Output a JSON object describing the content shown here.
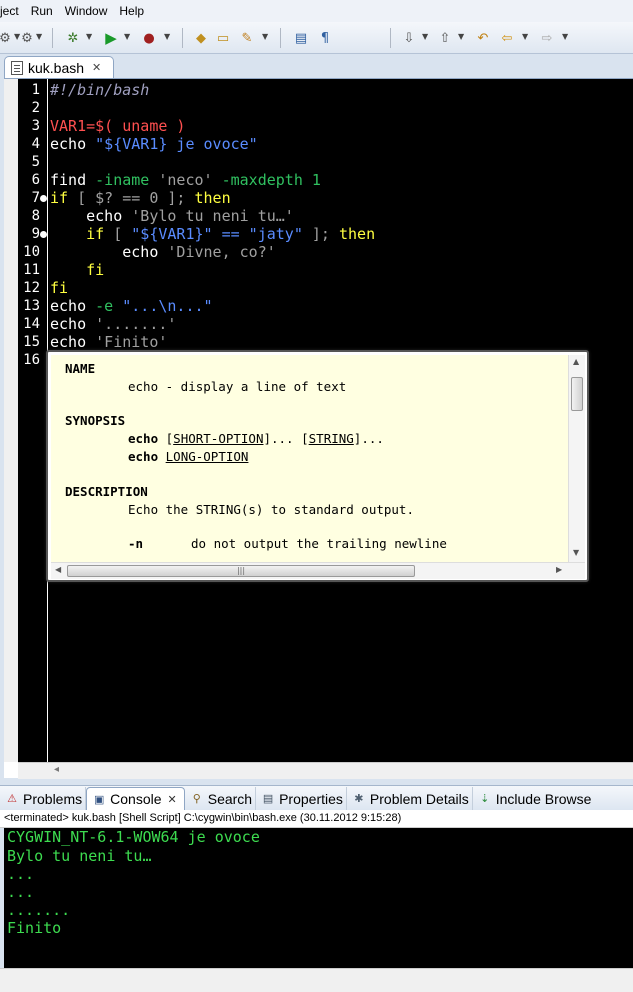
{
  "menubar": {
    "items": [
      "ject",
      "Run",
      "Window",
      "Help"
    ]
  },
  "editor": {
    "tab_label": "kuk.bash",
    "line_numbers": [
      "1",
      "2",
      "3",
      "4",
      "5",
      "6",
      "7",
      "8",
      "9",
      "10",
      "11",
      "12",
      "13",
      "14",
      "15",
      "16"
    ],
    "lines": [
      [
        {
          "t": "#!/bin/bash",
          "c": "c-comment"
        }
      ],
      [],
      [
        {
          "t": "VAR1=$( uname )",
          "c": "c-var"
        }
      ],
      [
        {
          "t": "echo ",
          "c": "c-cmd"
        },
        {
          "t": "\"${VAR1} je ovoce\"",
          "c": "c-str"
        }
      ],
      [],
      [
        {
          "t": "find ",
          "c": "c-cmd"
        },
        {
          "t": "-iname ",
          "c": "c-opt"
        },
        {
          "t": "'neco' ",
          "c": "c-sq"
        },
        {
          "t": "-maxdepth 1",
          "c": "c-opt"
        }
      ],
      [
        {
          "t": "if ",
          "c": "c-kw"
        },
        {
          "t": "[ $? == 0 ]; ",
          "c": "c-sq"
        },
        {
          "t": "then",
          "c": "c-kw"
        }
      ],
      [
        {
          "t": "    echo ",
          "c": "c-cmd"
        },
        {
          "t": "'Bylo tu neni tu…'",
          "c": "c-sq"
        }
      ],
      [
        {
          "t": "    if ",
          "c": "c-kw"
        },
        {
          "t": "[ ",
          "c": "c-sq"
        },
        {
          "t": "\"${VAR1}\" == \"jaty\"",
          "c": "c-str"
        },
        {
          "t": " ]; ",
          "c": "c-sq"
        },
        {
          "t": "then",
          "c": "c-kw"
        }
      ],
      [
        {
          "t": "        echo ",
          "c": "c-cmd"
        },
        {
          "t": "'Divne, co?'",
          "c": "c-sq"
        }
      ],
      [
        {
          "t": "    fi",
          "c": "c-kw"
        }
      ],
      [
        {
          "t": "fi",
          "c": "c-kw"
        }
      ],
      [
        {
          "t": "echo ",
          "c": "c-cmd"
        },
        {
          "t": "-e ",
          "c": "c-opt"
        },
        {
          "t": "\"...\\n...\"",
          "c": "c-str"
        }
      ],
      [
        {
          "t": "echo ",
          "c": "c-cmd"
        },
        {
          "t": "'.......'",
          "c": "c-sq"
        }
      ],
      [
        {
          "t": "echo ",
          "c": "c-cmd"
        },
        {
          "t": "'Finito'",
          "c": "c-sq"
        }
      ],
      []
    ]
  },
  "hover": {
    "name_heading": "NAME",
    "name_text": "echo - display a line of text",
    "synopsis_heading": "SYNOPSIS",
    "syn1_cmd": "echo",
    "syn1_open": " [",
    "syn1_arg": "SHORT-OPTION",
    "syn1_mid": "]... [",
    "syn1_arg2": "STRING",
    "syn1_close": "]...",
    "syn2_cmd": "echo",
    "syn2_arg": "LONG-OPTION",
    "description_heading": "DESCRIPTION",
    "desc_text": "Echo the STRING(s) to standard output.",
    "opt_flag": "-n",
    "opt_text": "do not output the trailing newline"
  },
  "views": {
    "tabs": [
      {
        "label": "Problems",
        "icon": "problems-icon"
      },
      {
        "label": "Console",
        "icon": "console-icon"
      },
      {
        "label": "Search",
        "icon": "search-icon"
      },
      {
        "label": "Properties",
        "icon": "properties-icon"
      },
      {
        "label": "Problem Details",
        "icon": "problem-details-icon"
      },
      {
        "label": "Include Browse",
        "icon": "include-browser-icon"
      }
    ]
  },
  "console": {
    "header": "<terminated> kuk.bash [Shell Script] C:\\cygwin\\bin\\bash.exe (30.11.2012 9:15:28)",
    "output": [
      "CYGWIN_NT-6.1-WOW64 je ovoce",
      "Bylo tu neni tu…",
      "...",
      "...",
      ".......",
      "Finito"
    ]
  },
  "colors": {
    "editor_bg": "#000000",
    "hover_bg": "#ffffe1",
    "console_text": "#3ddc50"
  }
}
